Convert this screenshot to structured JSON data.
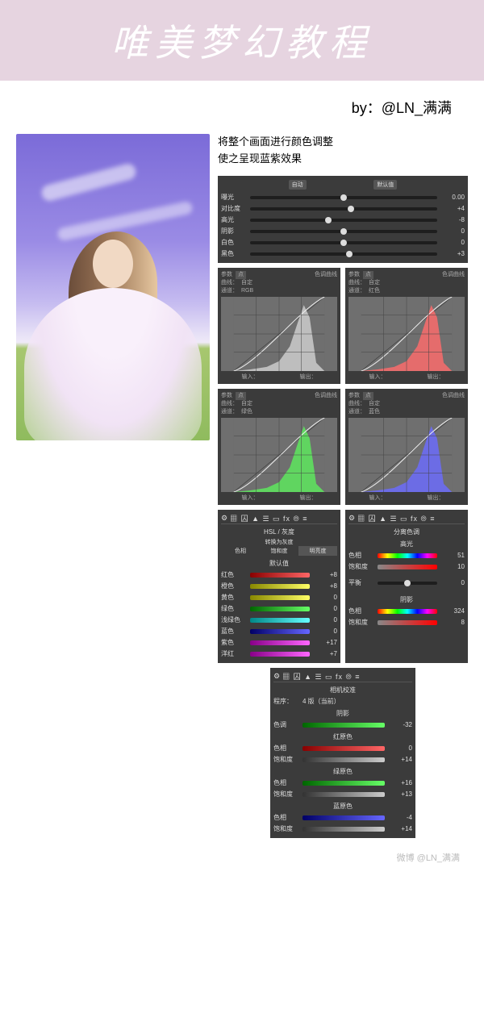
{
  "banner": {
    "title": "唯美梦幻教程"
  },
  "byline": "by：@LN_满满",
  "description": {
    "line1": "将整个画面进行颜色调整",
    "line2": "使之呈现蓝紫效果"
  },
  "basic": {
    "auto": "自动",
    "default": "默认值",
    "sliders": [
      {
        "label": "曝光",
        "value": "0.00",
        "pos": 50
      },
      {
        "label": "对比度",
        "value": "+4",
        "pos": 54
      },
      {
        "label": "高光",
        "value": "-8",
        "pos": 42
      },
      {
        "label": "阴影",
        "value": "0",
        "pos": 50
      },
      {
        "label": "白色",
        "value": "0",
        "pos": 50
      },
      {
        "label": "黑色",
        "value": "+3",
        "pos": 53
      }
    ]
  },
  "curves": {
    "title": "色调曲线",
    "parametric_label": "参数",
    "point_label": "点",
    "curve_label": "曲线：",
    "custom": "自定",
    "channel_label": "通道：",
    "input_label": "输入：",
    "output_label": "输出：",
    "panels": [
      {
        "channel": "RGB",
        "fill": "#c6c6c6"
      },
      {
        "channel": "红色",
        "fill": "#f26b6b"
      },
      {
        "channel": "绿色",
        "fill": "#5ee05e"
      },
      {
        "channel": "蓝色",
        "fill": "#6b6bf2"
      }
    ]
  },
  "hsl": {
    "title": "HSL / 灰度",
    "convert": "转换为灰度",
    "tabs": {
      "hue": "色相",
      "sat": "饱和度",
      "lum": "明亮度"
    },
    "default_label": "默认值",
    "sliders": [
      {
        "label": "红色",
        "value": "+8",
        "pos": 58,
        "grad": "red-grad"
      },
      {
        "label": "橙色",
        "value": "+8",
        "pos": 58,
        "grad": "yel-grad"
      },
      {
        "label": "黄色",
        "value": "0",
        "pos": 50,
        "grad": "yel-grad"
      },
      {
        "label": "绿色",
        "value": "0",
        "pos": 50,
        "grad": "grn-grad"
      },
      {
        "label": "浅绿色",
        "value": "0",
        "pos": 50,
        "grad": "cyn-grad"
      },
      {
        "label": "蓝色",
        "value": "0",
        "pos": 50,
        "grad": "blu-grad"
      },
      {
        "label": "紫色",
        "value": "+17",
        "pos": 67,
        "grad": "mag-grad"
      },
      {
        "label": "洋红",
        "value": "+7",
        "pos": 57,
        "grad": "mag-grad"
      }
    ]
  },
  "split": {
    "title": "分离色调",
    "highlights": "高光",
    "shadows": "阴影",
    "hue_label": "色相",
    "sat_label": "饱和度",
    "balance_label": "平衡",
    "hi_hue": "51",
    "hi_sat": "10",
    "balance": "0",
    "sh_hue": "324",
    "sh_sat": "8"
  },
  "calib": {
    "title": "相机校准",
    "profile_label": "程序：",
    "profile_value": "4 版（当前）",
    "shadow": "阴影",
    "tint_label": "色调",
    "tint_value": "-32",
    "sections": [
      {
        "name": "红原色",
        "hue": "0",
        "sat": "+14"
      },
      {
        "name": "绿原色",
        "hue": "+16",
        "sat": "+13"
      },
      {
        "name": "蓝原色",
        "hue": "-4",
        "sat": "+14"
      }
    ],
    "hue_label": "色相",
    "sat_label": "饱和度"
  },
  "icons": {
    "gear": "⚙",
    "strip": "▦ 囚 ▲ ☰ ▭ fx ⦾ ≡"
  },
  "watermark": "微博 @LN_满满"
}
